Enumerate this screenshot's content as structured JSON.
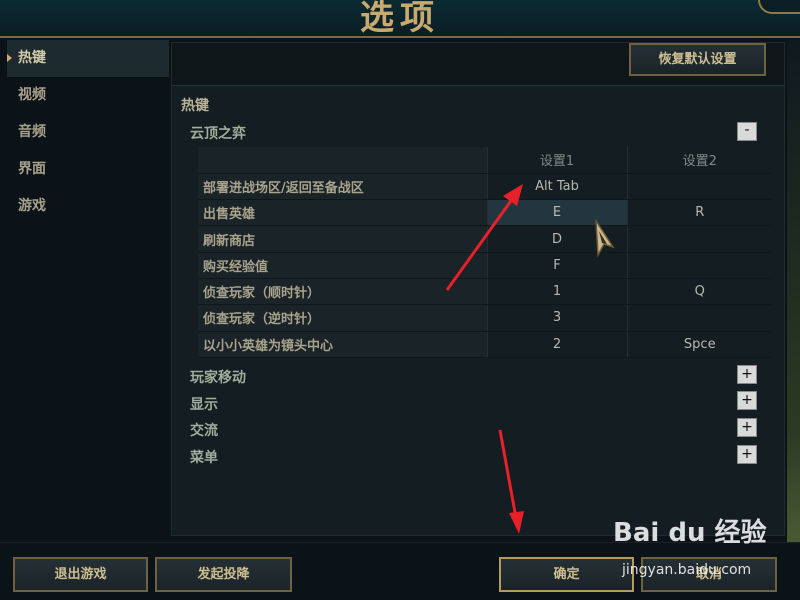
{
  "window": {
    "title": "选项"
  },
  "sidebar": {
    "items": [
      {
        "label": "热键",
        "active": true
      },
      {
        "label": "视频",
        "active": false
      },
      {
        "label": "音频",
        "active": false
      },
      {
        "label": "界面",
        "active": false
      },
      {
        "label": "游戏",
        "active": false
      }
    ]
  },
  "header": {
    "reset_label": "恢复默认设置"
  },
  "section": {
    "title": "热键"
  },
  "group": {
    "title": "云顶之弈",
    "collapse_glyph": "-",
    "columns": {
      "key1": "设置1",
      "key2": "设置2"
    },
    "rows": [
      {
        "action": "部署进战场区/返回至备战区",
        "key1": "Alt Tab",
        "key2": ""
      },
      {
        "action": "出售英雄",
        "key1": "E",
        "key2": "R"
      },
      {
        "action": "刷新商店",
        "key1": "D",
        "key2": ""
      },
      {
        "action": "购买经验值",
        "key1": "F",
        "key2": ""
      },
      {
        "action": "侦查玩家（顺时针）",
        "key1": "1",
        "key2": "Q"
      },
      {
        "action": "侦查玩家（逆时针）",
        "key1": "3",
        "key2": ""
      },
      {
        "action": "以小小英雄为镜头中心",
        "key1": "2",
        "key2": "Spce"
      }
    ]
  },
  "collapsed_groups": [
    {
      "title": "玩家移动",
      "expand_glyph": "+"
    },
    {
      "title": "显示",
      "expand_glyph": "+"
    },
    {
      "title": "交流",
      "expand_glyph": "+"
    },
    {
      "title": "菜单",
      "expand_glyph": "+"
    }
  ],
  "footer": {
    "quit_label": "退出游戏",
    "surrender_label": "发起投降",
    "confirm_label": "确定",
    "cancel_label": "取消"
  },
  "watermark": {
    "logo": "Bai du 经验",
    "url": "jingyan.baidu.com"
  },
  "colors": {
    "gold": "#c8aa6e",
    "panel": "#131d22",
    "annotation_arrow": "#e8202a"
  }
}
